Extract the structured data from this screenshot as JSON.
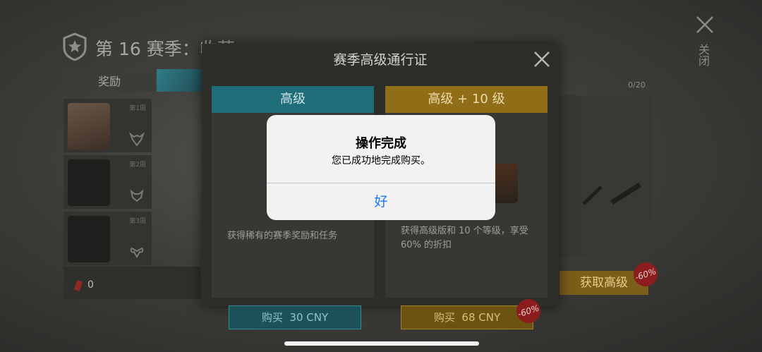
{
  "background": {
    "season_title": "第 16 赛季：收获",
    "close_label": "关闭",
    "rewards_tab": "奖励",
    "weeks": [
      "第1周",
      "第2周",
      "第3周"
    ],
    "progress": "0/20",
    "dynamite_count": "0",
    "get_premium_label": "获取高级",
    "get_premium_discount": "-60%"
  },
  "modal": {
    "title": "赛季高级通行证",
    "cards": [
      {
        "header": "高级",
        "description": "获得稀有的赛季奖励和任务",
        "buy_label": "购买",
        "price": "30 CNY"
      },
      {
        "header": "高级 + 10 级",
        "description_line1": "获得高级版和 10 个等级，享受",
        "description_line2": "60% 的折扣",
        "buy_label": "购买",
        "price": "68 CNY",
        "discount": "-60%"
      }
    ]
  },
  "alert": {
    "title": "操作完成",
    "message": "您已成功地完成购买。",
    "ok_label": "好"
  },
  "colors": {
    "premium_header": "#1e7f8c",
    "premium_plus_header": "#a8801a",
    "alert_button": "#1b79f5"
  }
}
